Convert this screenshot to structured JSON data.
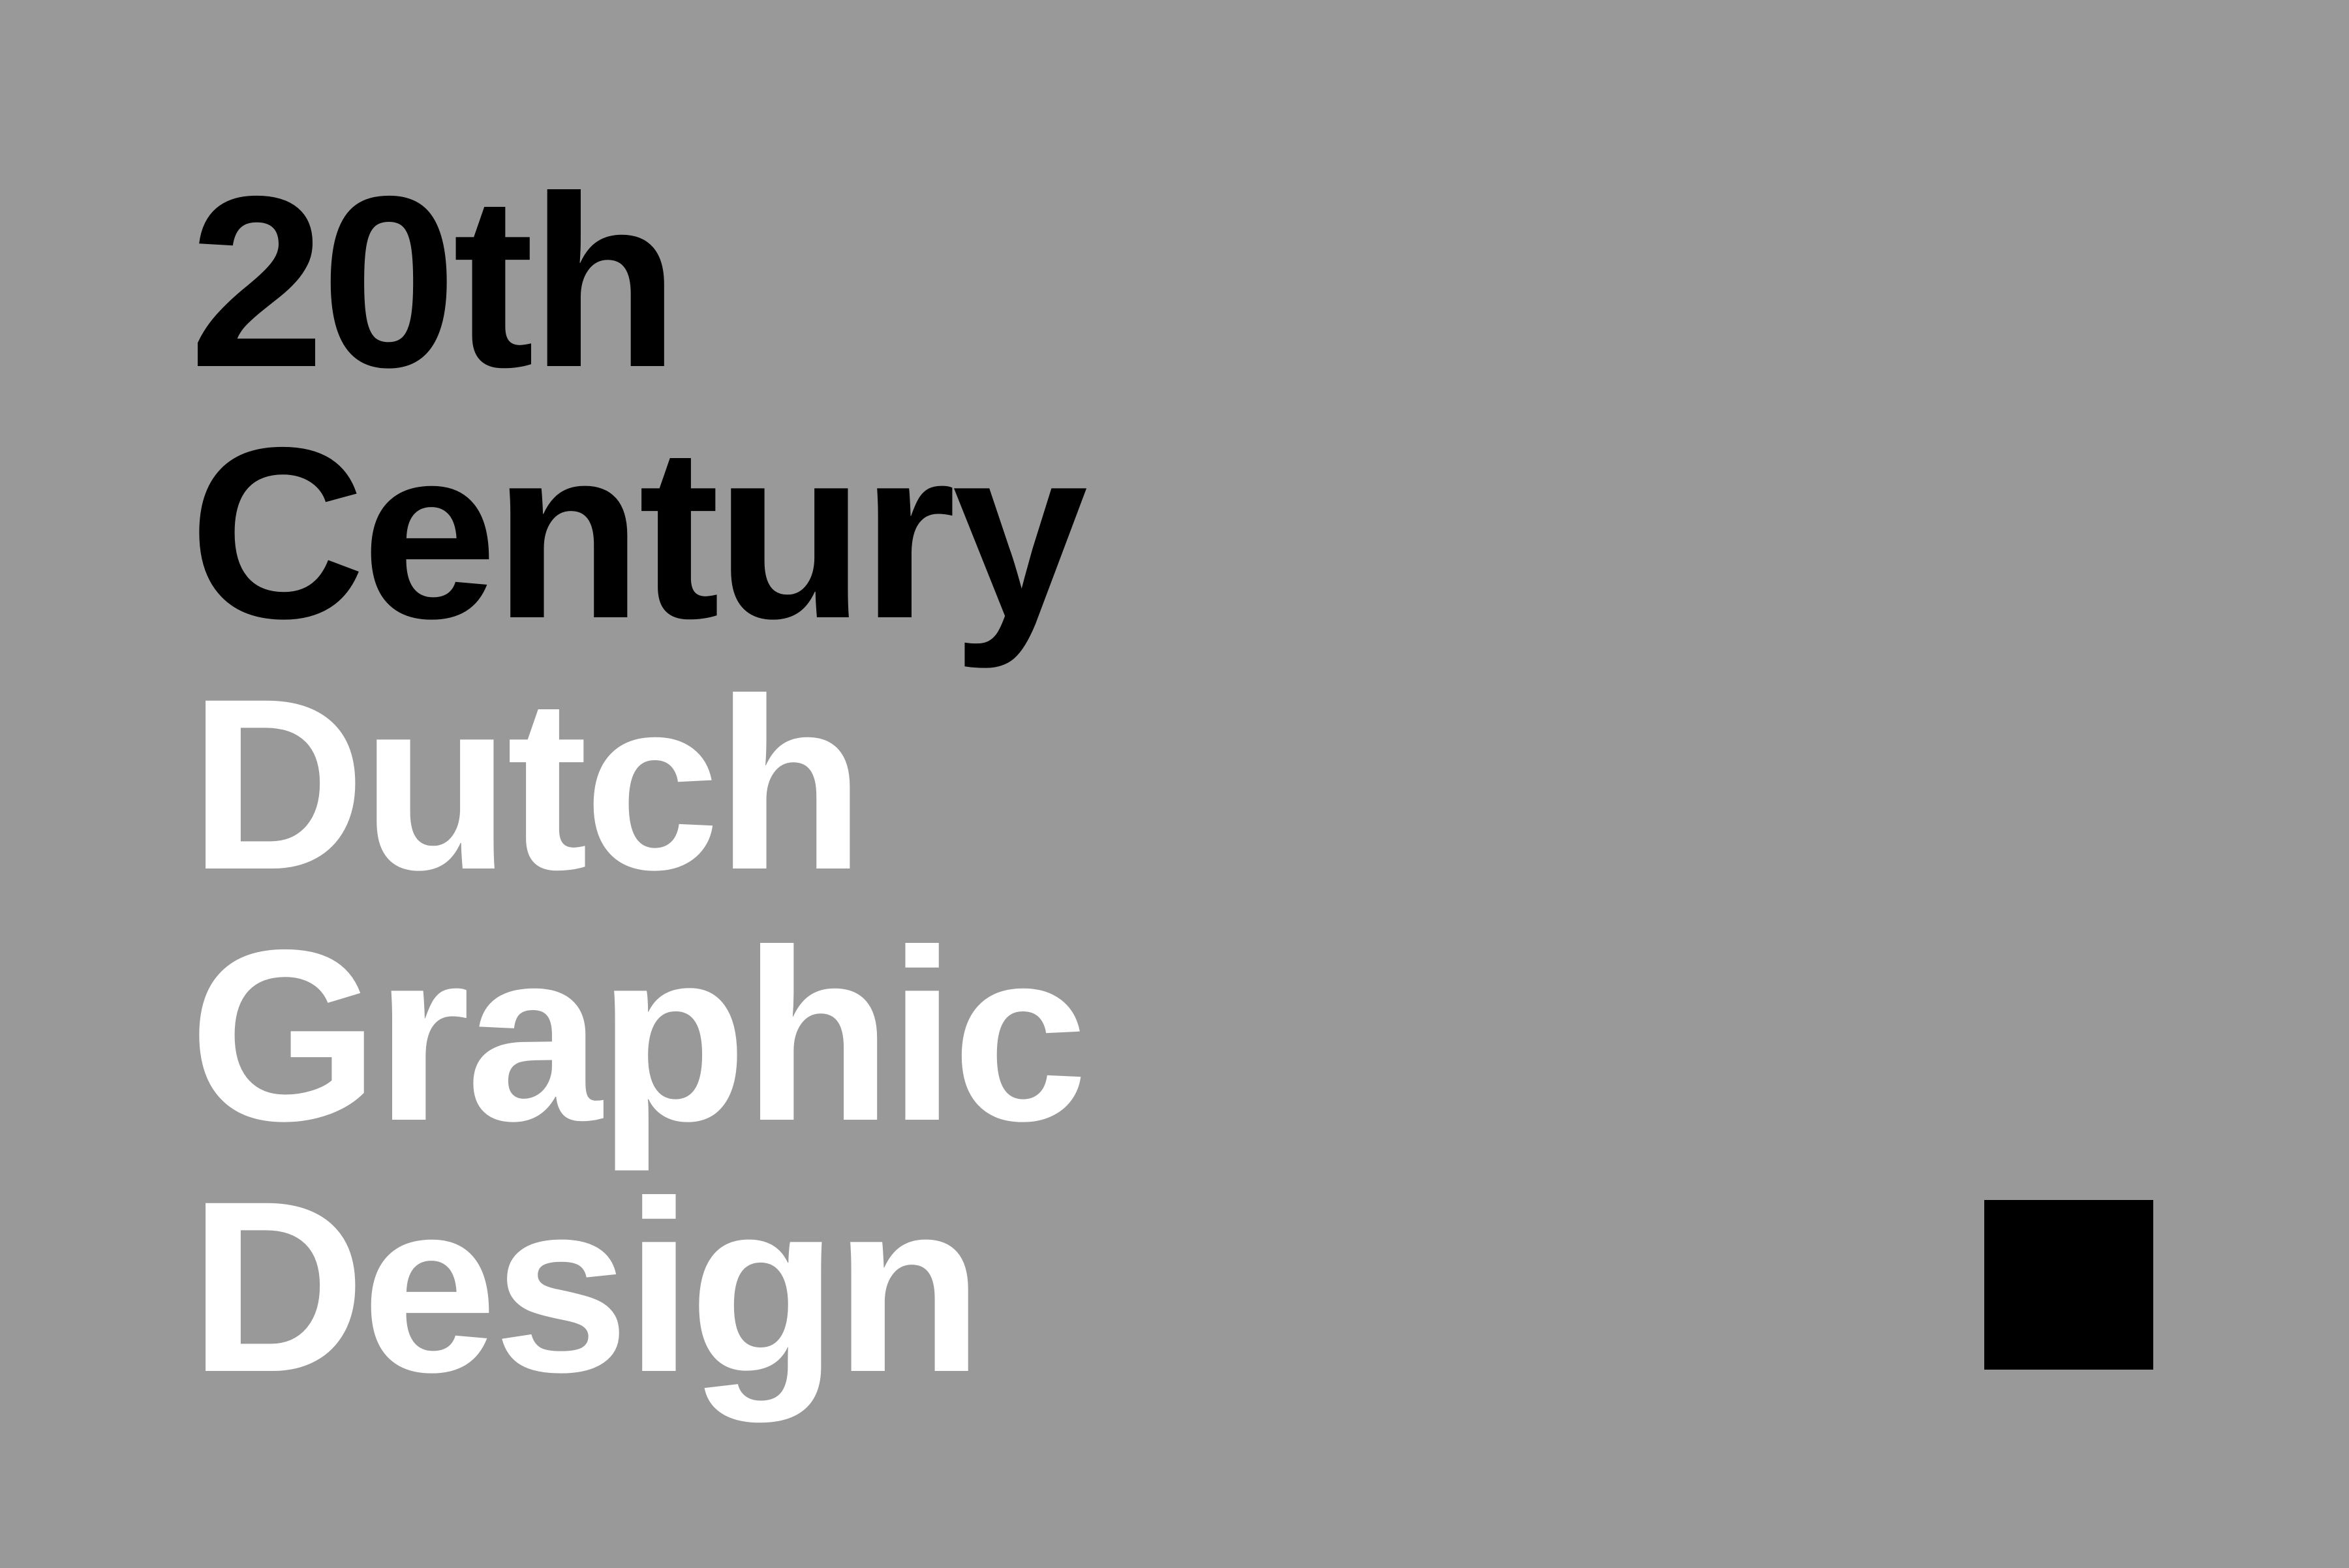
{
  "poster": {
    "background_color": "#999999",
    "title_lines": [
      {
        "text": "20th",
        "color": "#000000"
      },
      {
        "text": "Century",
        "color": "#000000"
      },
      {
        "text": "Dutch",
        "color": "#ffffff"
      },
      {
        "text": "Graphic",
        "color": "#ffffff"
      },
      {
        "text": "Design",
        "color": "#ffffff"
      }
    ],
    "accent_square": {
      "color": "#000000"
    }
  }
}
